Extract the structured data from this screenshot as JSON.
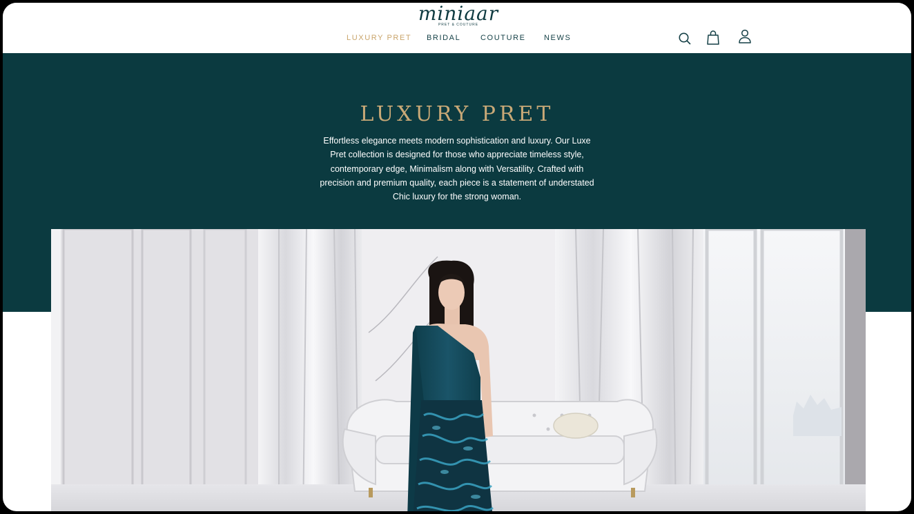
{
  "brand": {
    "name": "miniaar",
    "tagline": "PRET & COUTURE"
  },
  "nav": {
    "items": [
      {
        "label": "LUXURY PRET",
        "active": true
      },
      {
        "label": "BRIDAL",
        "active": false
      },
      {
        "label": "COUTURE",
        "active": false
      },
      {
        "label": "NEWS",
        "active": false
      }
    ]
  },
  "header_icons": [
    "search-icon",
    "shopping-bag-icon",
    "account-icon"
  ],
  "hero": {
    "title": "LUXURY PRET",
    "description": "Effortless elegance meets modern sophistication and luxury. Our Luxe Pret collection is designed for those who appreciate timeless style, contemporary edge, Minimalism along with Versatility. Crafted with precision and premium quality, each piece is a statement of understated Chic luxury for the strong woman."
  },
  "colors": {
    "teal": "#0b3a40",
    "gold": "#c9a977",
    "active_nav": "#c9a46a",
    "nav_text": "#133f45",
    "dress": "#14495a"
  }
}
